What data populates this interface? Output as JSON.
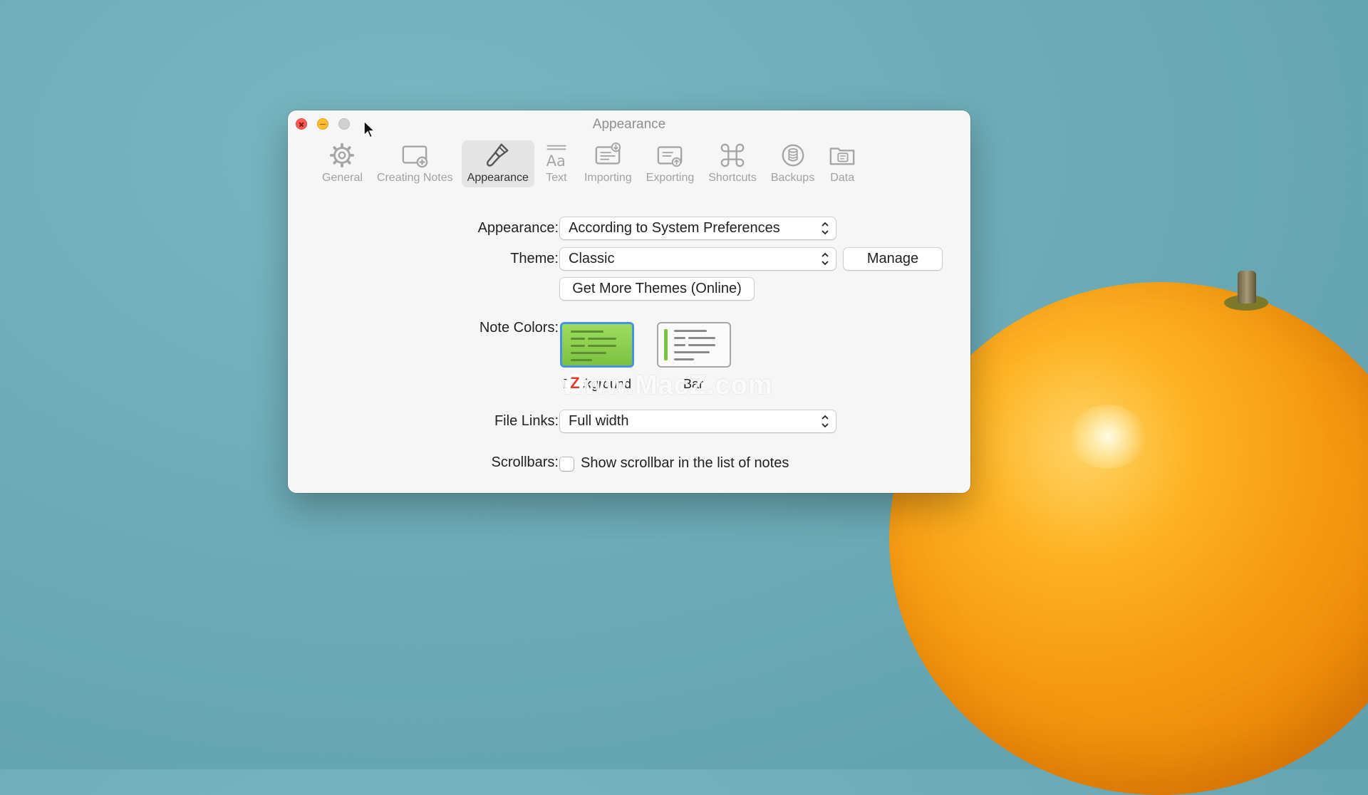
{
  "window": {
    "title": "Appearance"
  },
  "toolbar": {
    "items": [
      {
        "label": "General",
        "icon": "gear-icon"
      },
      {
        "label": "Creating Notes",
        "icon": "new-note-icon"
      },
      {
        "label": "Appearance",
        "icon": "paintbrush-icon",
        "active": true
      },
      {
        "label": "Text",
        "icon": "text-icon"
      },
      {
        "label": "Importing",
        "icon": "import-icon"
      },
      {
        "label": "Exporting",
        "icon": "export-icon"
      },
      {
        "label": "Shortcuts",
        "icon": "command-icon"
      },
      {
        "label": "Backups",
        "icon": "backups-icon"
      },
      {
        "label": "Data",
        "icon": "data-folder-icon"
      }
    ]
  },
  "form": {
    "appearance_label": "Appearance:",
    "appearance_value": "According to System Preferences",
    "theme_label": "Theme:",
    "theme_value": "Classic",
    "manage_button": "Manage",
    "get_more_themes_button": "Get More Themes (Online)",
    "note_colors_label": "Note Colors:",
    "note_colors_caption_1": "Background",
    "note_colors_caption_2": "Bar",
    "file_links_label": "File Links:",
    "file_links_value": "Full width",
    "scrollbars_label": "Scrollbars:",
    "scrollbars_checkbox_label": "Show scrollbar in the list of notes"
  },
  "watermark": {
    "text": "www.MacZ.com",
    "logo": "Z"
  },
  "colors": {
    "desktop": "#6eadb9",
    "selected_swatch_border": "#4a90e2",
    "green_swatch": "#8ccf4d"
  }
}
